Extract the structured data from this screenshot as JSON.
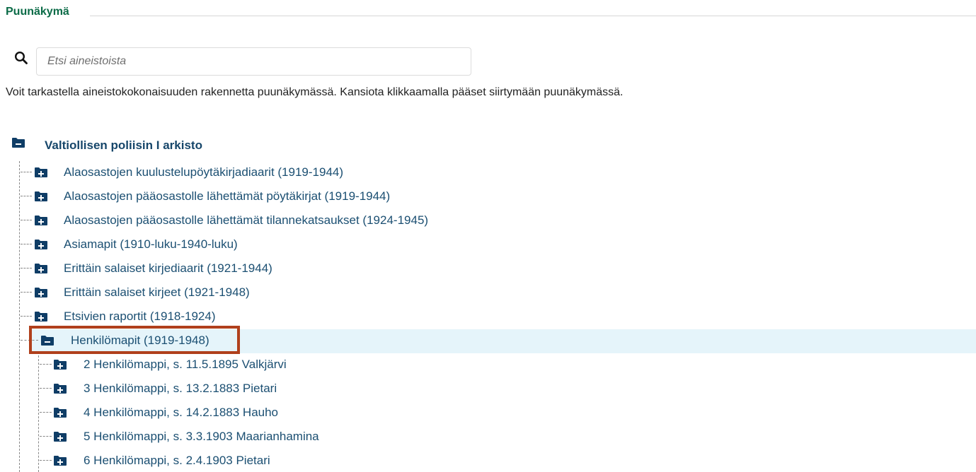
{
  "header": {
    "title": "Puunäkymä"
  },
  "search": {
    "placeholder": "Etsi aineistoista",
    "icon": "search-icon"
  },
  "intro_text": "Voit tarkastella aineistokokonaisuuden rakennetta puunäkymässä. Kansiota klikkaamalla pääset siirtymään puunäkymässä.",
  "colors": {
    "accent": "#0b6b47",
    "link": "#1b4f72",
    "folder": "#0f3d66",
    "selection_bg": "#e5f4fa",
    "selection_border": "#b0401c"
  },
  "tree": {
    "root": {
      "label": "Valtiollisen poliisin I arkisto",
      "state": "expanded"
    },
    "children": [
      {
        "label": "Alaosastojen kuulustelupöytäkirjadiaarit (1919-1944)",
        "state": "collapsed"
      },
      {
        "label": "Alaosastojen pääosastolle lähettämät pöytäkirjat (1919-1944)",
        "state": "collapsed"
      },
      {
        "label": "Alaosastojen pääosastolle lähettämät tilannekatsaukset (1924-1945)",
        "state": "collapsed"
      },
      {
        "label": "Asiamapit (1910-luku-1940-luku)",
        "state": "collapsed"
      },
      {
        "label": "Erittäin salaiset kirjediaarit (1921-1944)",
        "state": "collapsed"
      },
      {
        "label": "Erittäin salaiset kirjeet (1921-1948)",
        "state": "collapsed"
      },
      {
        "label": "Etsivien raportit (1918-1924)",
        "state": "collapsed"
      },
      {
        "label": "Henkilömapit (1919-1948)",
        "state": "expanded",
        "selected": true
      }
    ],
    "grandchildren": [
      {
        "label": "2 Henkilömappi, s. 11.5.1895 Valkjärvi",
        "state": "collapsed"
      },
      {
        "label": "3 Henkilömappi, s. 13.2.1883 Pietari",
        "state": "collapsed"
      },
      {
        "label": "4 Henkilömappi, s. 14.2.1883 Hauho",
        "state": "collapsed"
      },
      {
        "label": "5 Henkilömappi, s. 3.3.1903 Maarianhamina",
        "state": "collapsed"
      },
      {
        "label": "6 Henkilömappi, s. 2.4.1903 Pietari",
        "state": "collapsed"
      }
    ]
  }
}
